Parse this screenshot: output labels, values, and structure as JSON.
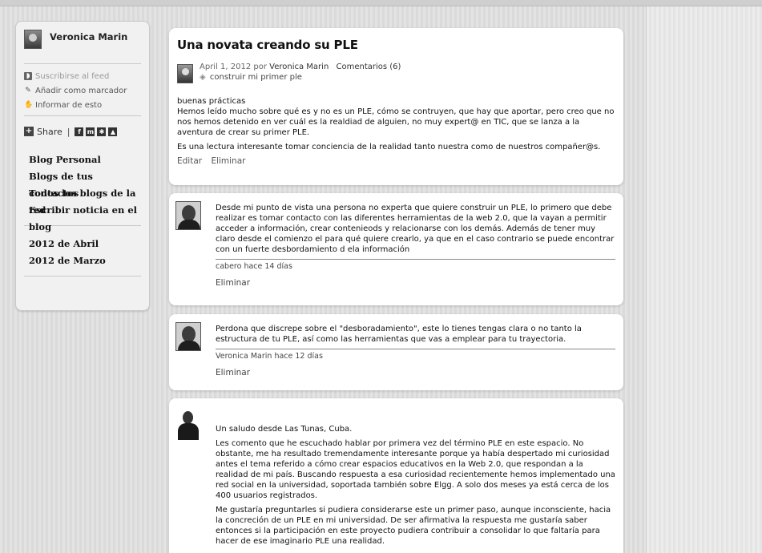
{
  "sidebar": {
    "profile_name": "Veronica Marin",
    "feed_links": [
      {
        "label": "Suscribirse al feed",
        "icon": "rss-icon"
      },
      {
        "label": "Añadir como marcador",
        "icon": "bookmark-icon"
      },
      {
        "label": "Informar de esto",
        "icon": "report-icon"
      }
    ],
    "share_label": "Share",
    "nav_items": [
      "Blog Personal",
      "Blogs de tus contactos",
      "Todos los blogs de la red",
      "Escribir noticia en el blog"
    ],
    "archive": [
      "2012 de Abril",
      "2012 de Marzo"
    ]
  },
  "post": {
    "title": "Una novata creando su PLE",
    "date": "April 1, 2012 por",
    "author": "Veronica Marin",
    "comments_link": "Comentarios (6)",
    "tag": "construir mi primer ple",
    "body": [
      "buenas prácticas",
      "Hemos leído mucho sobre qué es y no es un PLE, cómo se contruyen, que hay que aportar, pero creo que no nos hemos detenido en ver cuál es la realdiad de alguien, no muy expert@ en TIC, que se lanza a la aventura de crear su primer PLE.",
      "Es una lectura interesante tomar conciencia de la realidad tanto nuestra como de nuestros compañer@s."
    ],
    "edit_label": "Editar",
    "delete_label": "Eliminar"
  },
  "comments": [
    {
      "paragraphs": [
        "Desde mi punto de vista una persona no experta que quiere construir un PLE, lo primero que debe realizar es tomar contacto con las diferentes herramientas de la web 2.0, que la vayan a permitir acceder a información, crear contenieods y relacionarse con los demás. Además de tener muy claro desde el comienzo el para qué quiere crearlo, ya que en el caso contrario se puede encontrar con un fuerte desbordamiento d ela información"
      ],
      "signature": "cabero hace 14 días",
      "delete_label": "Eliminar"
    },
    {
      "paragraphs": [
        "Perdona que discrepe sobre el \"desboradamiento\", este lo tienes tengas clara o no tanto la estructura de tu PLE, así como las herramientas que vas a emplear para tu trayectoria."
      ],
      "signature": "Veronica Marin hace 12 días",
      "delete_label": "Eliminar"
    },
    {
      "paragraphs": [
        "Un saludo desde Las Tunas, Cuba.",
        "Les comento que he escuchado hablar por primera vez del término PLE en este espacio. No obstante, me ha resultado tremendamente interesante porque ya había despertado mi curiosidad antes el tema referido a cómo crear espacios educativos en la Web 2.0, que respondan a la realidad de mi país. Buscando respuesta a esa curiosidad recientemente hemos implementado una red social en la universidad, soportada también sobre Elgg. A solo dos meses ya está cerca de los 400 usuarios  registrados.",
        "Me gustaría preguntarles si pudiera considerarse este un primer paso, aunque inconsciente, hacia la concreción de un PLE en mi universidad. De ser afirmativa la respuesta me gustaría saber entonces si la participación en este proyecto pudiera contribuir a consolidar lo que faltaría para hacer de ese imaginario PLE una realidad."
      ]
    }
  ]
}
